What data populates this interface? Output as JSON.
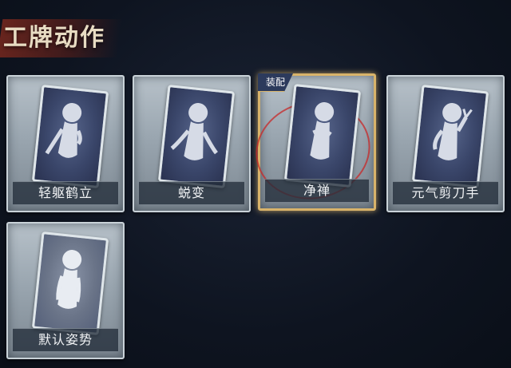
{
  "header": {
    "title": "工牌动作"
  },
  "cards": [
    {
      "label": "轻躯鹤立",
      "equipped": false
    },
    {
      "label": "蜕变",
      "equipped": false
    },
    {
      "label": "净禅",
      "equipped": true,
      "badge": "装配"
    },
    {
      "label": "元气剪刀手",
      "equipped": false
    },
    {
      "label": "默认姿势",
      "equipped": false
    }
  ],
  "colors": {
    "equipped_border": "#d8b36a",
    "card_bg": "#9aa6b0",
    "label_bg": "#232d3a"
  }
}
